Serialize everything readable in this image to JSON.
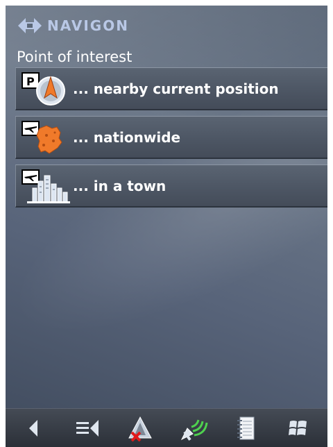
{
  "brand": {
    "name": "NAVIGON",
    "accent": "#b9c8e6"
  },
  "page": {
    "title": "Point of interest"
  },
  "menu": {
    "items": [
      {
        "label": "... nearby current position",
        "icon": "nearby-poi-icon"
      },
      {
        "label": "... nationwide",
        "icon": "nationwide-map-icon"
      },
      {
        "label": "... in a town",
        "icon": "town-skyline-icon"
      }
    ]
  },
  "toolbar": {
    "buttons": [
      {
        "icon": "back-arrow-icon"
      },
      {
        "icon": "menu-list-icon"
      },
      {
        "icon": "route-cancel-icon"
      },
      {
        "icon": "gps-satellite-icon"
      },
      {
        "icon": "notebook-icon"
      },
      {
        "icon": "windows-start-icon"
      }
    ]
  },
  "colors": {
    "background": "#5c6879",
    "button": "#4d5664",
    "poi_orange": "#f07a2a"
  }
}
